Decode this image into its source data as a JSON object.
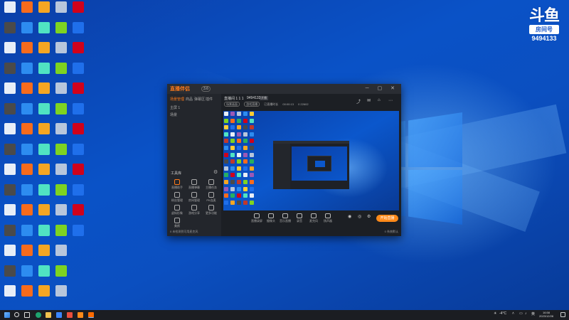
{
  "brand": {
    "logo": "斗鱼",
    "tag": "房间号",
    "room": "9494133"
  },
  "app": {
    "title": "直播伴侣",
    "version": "3.6",
    "window_buttons": "─ ▢ ✕",
    "sidebar_tabs": [
      "场景管理",
      "商品",
      "弹幕区",
      "插件"
    ],
    "scene_rows": [
      "主屏 1",
      "场景"
    ],
    "tools_heading": "工具库",
    "tools": [
      {
        "label": "直播助手"
      },
      {
        "label": "直播弹幕"
      },
      {
        "label": "主播任务"
      },
      {
        "label": "粉丝管理"
      },
      {
        "label": "房间管理"
      },
      {
        "label": "PK连麦"
      },
      {
        "label": "虚拟形象"
      },
      {
        "label": "游戏分享"
      },
      {
        "label": "更多功能"
      },
      {
        "label": "美颜"
      }
    ],
    "sidebar_footer": "0 未检测到可用麦克风",
    "room_title": "直播间 1 1 1",
    "room_id": "9494133",
    "room_badge": "开播",
    "info_row": [
      "场景画面",
      "游戏直播",
      "已直播时长",
      "00:00:13",
      "0 22602"
    ],
    "controls": [
      {
        "label": "直播录屏"
      },
      {
        "label": "摄像头"
      },
      {
        "label": "音乐直播"
      },
      {
        "label": "录音"
      },
      {
        "label": "麦克风"
      },
      {
        "label": "扬声器"
      }
    ],
    "start_live": "开始直播",
    "main_footer": "0 系统默认"
  },
  "taskbar": {
    "search": "搜索",
    "weather": "-4°C",
    "lang": "英",
    "time": "16:58",
    "date": "2023/12/28"
  }
}
